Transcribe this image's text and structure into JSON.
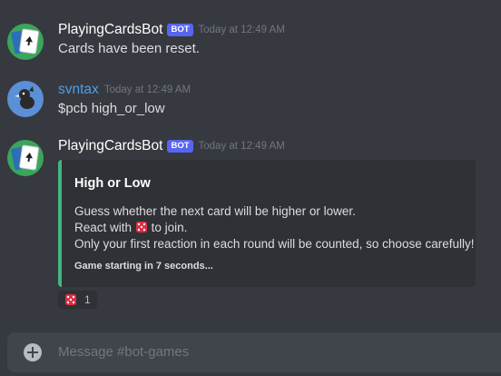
{
  "messages": [
    {
      "author": "PlayingCardsBot",
      "badge": "BOT",
      "timestamp": "Today at 12:49 AM",
      "text": "Cards have been reset."
    },
    {
      "author": "svntax",
      "timestamp": "Today at 12:49 AM",
      "text": "$pcb high_or_low"
    },
    {
      "author": "PlayingCardsBot",
      "badge": "BOT",
      "timestamp": "Today at 12:49 AM",
      "embed": {
        "title": "High or Low",
        "line1": "Guess whether the next card will be higher or lower.",
        "line2_before": "React with",
        "line2_after": "to join.",
        "line3": "Only your first reaction in each round will be counted, so choose carefully!",
        "footer": "Game starting in 7 seconds...",
        "accent_color": "#43b581"
      },
      "reaction": {
        "emoji": "game-die-icon",
        "count": "1"
      }
    }
  ],
  "composer": {
    "placeholder": "Message #bot-games"
  }
}
